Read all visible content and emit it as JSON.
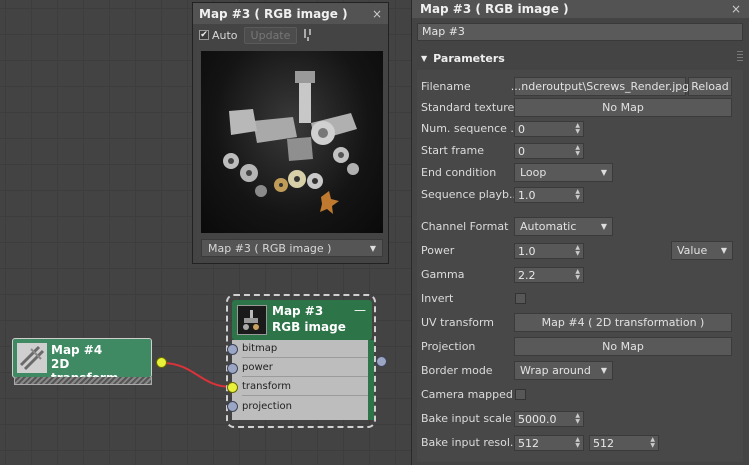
{
  "preview": {
    "title": "Map #3  ( RGB image )",
    "close": "×",
    "auto_label": "Auto",
    "auto_checked": true,
    "update_label": "Update",
    "select_value": "Map #3  ( RGB image )"
  },
  "nodes": {
    "map4": {
      "line1": "Map #4",
      "line2": "2D transform..."
    },
    "map3": {
      "line1": "Map #3",
      "line2": "RGB image",
      "min": "—",
      "ports": [
        "bitmap",
        "power",
        "transform",
        "projection"
      ]
    }
  },
  "panel": {
    "title": "Map #3  ( RGB image )",
    "close": "×",
    "name_value": "Map #3",
    "rollout": "Parameters",
    "params": {
      "filename": {
        "label": "Filename",
        "value": "...nderoutput\\Screws_Render.jpg",
        "reload": "Reload"
      },
      "standard_texture": {
        "label": "Standard texture",
        "value": "No Map"
      },
      "num_sequence": {
        "label": "Num. sequence ...",
        "value": "0"
      },
      "start_frame": {
        "label": "Start frame",
        "value": "0"
      },
      "end_condition": {
        "label": "End condition",
        "value": "Loop"
      },
      "sequence_playback": {
        "label": "Sequence playb...",
        "value": "1.0"
      },
      "channel_format": {
        "label": "Channel Format",
        "value": "Automatic"
      },
      "power": {
        "label": "Power",
        "value": "1.0",
        "mode": "Value"
      },
      "gamma": {
        "label": "Gamma",
        "value": "2.2"
      },
      "invert": {
        "label": "Invert",
        "checked": false
      },
      "uv_transform": {
        "label": "UV transform",
        "value": "Map #4  ( 2D transformation )"
      },
      "projection": {
        "label": "Projection",
        "value": "No Map"
      },
      "border_mode": {
        "label": "Border mode",
        "value": "Wrap around"
      },
      "camera_mapped": {
        "label": "Camera mapped",
        "checked": false
      },
      "bake_input_scale": {
        "label": "Bake input scale",
        "value": "5000.0"
      },
      "bake_input_resolution": {
        "label": "Bake input resol...",
        "value_x": "512",
        "value_y": "512"
      }
    }
  },
  "colors": {
    "node_green": "#3f8a63",
    "node_header_green": "#2d7448",
    "wire_red": "#d8333a",
    "socket_yellow": "#e8f23a"
  }
}
